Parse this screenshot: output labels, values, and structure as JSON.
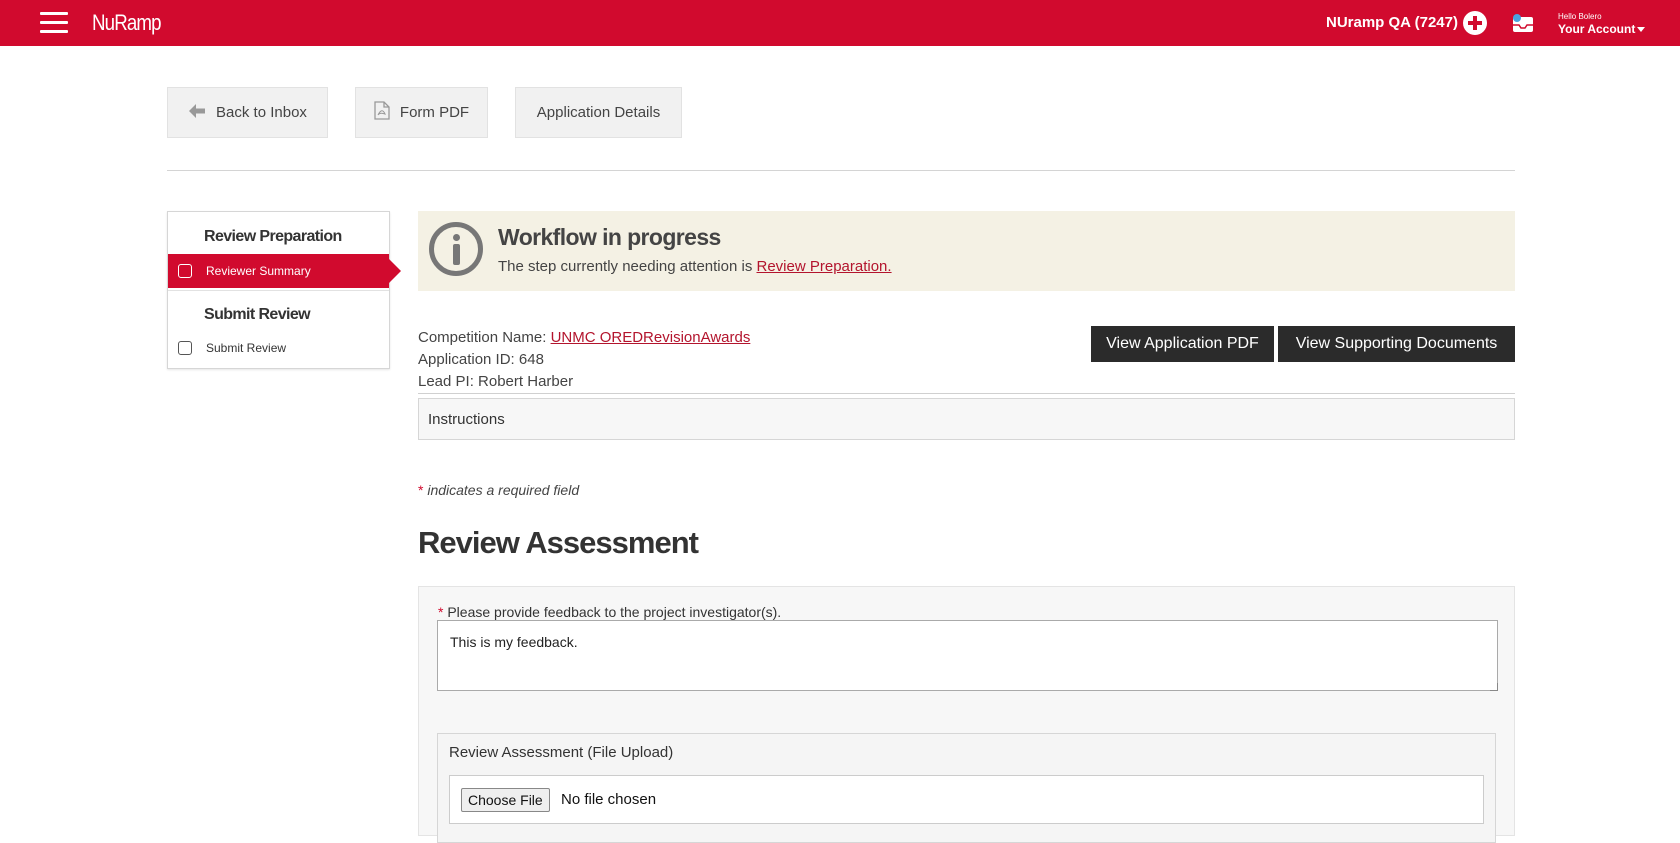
{
  "header": {
    "logo": "NuRamp",
    "org": "NUramp QA (7247)",
    "hello": "Hello Bolero",
    "account": "Your Account",
    "menu_icon": "hamburger-icon",
    "add_icon": "plus-circle-icon",
    "inbox_icon": "inbox-icon",
    "brand_color": "#d10a2e"
  },
  "nav": {
    "back": "Back to Inbox",
    "pdf": "Form PDF",
    "details": "Application Details"
  },
  "sidebar": {
    "sections": [
      {
        "title": "Review Preparation",
        "item": "Reviewer Summary"
      },
      {
        "title": "Submit Review",
        "item": "Submit Review"
      }
    ]
  },
  "alert": {
    "title": "Workflow in progress",
    "text": "The step currently needing attention is ",
    "link": "Review Preparation."
  },
  "application": {
    "competition_label": "Competition Name: ",
    "competition_value": "UNMC OREDRevisionAwards",
    "id_line": "Application ID: 648",
    "pi_line": "Lead PI: Robert Harber",
    "view_pdf": "View Application PDF",
    "view_docs": "View Supporting Documents",
    "instructions": "Instructions"
  },
  "form": {
    "required_star": "*",
    "required_note": " indicates a required field",
    "heading": "Review Assessment",
    "feedback_label": "Please provide feedback to the project investigator(s).",
    "feedback_value": "This is my feedback.",
    "upload_label": "Review Assessment (File Upload)",
    "choose_file": "Choose File",
    "no_file": "No file chosen"
  }
}
